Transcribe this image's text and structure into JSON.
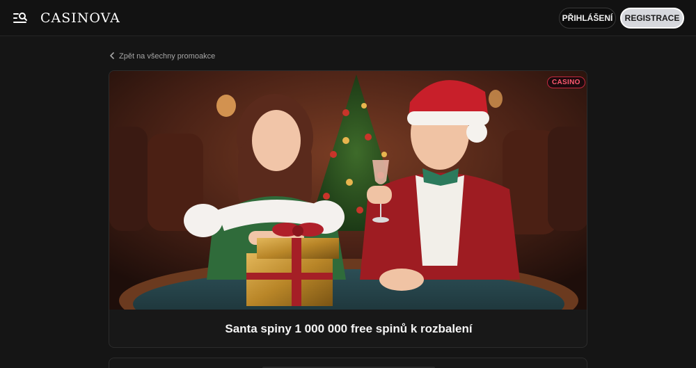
{
  "header": {
    "logo": "CASINOVA",
    "menu_icon": "menu-search-icon",
    "login_label": "PŘIHLÁŠENÍ",
    "register_label": "REGISTRACE"
  },
  "back_link": {
    "icon": "chevron-left-icon",
    "label": "Zpět na všechny promoakce"
  },
  "promo": {
    "badge": "CASINO",
    "title": "Santa spiny 1 000 000 free spinů k rozbalení",
    "image_icon": "promo-illustration"
  },
  "colors": {
    "background": "#151515",
    "card": "#181818",
    "badge_accent": "#c2283f",
    "register_button": "#d6d8dd"
  }
}
